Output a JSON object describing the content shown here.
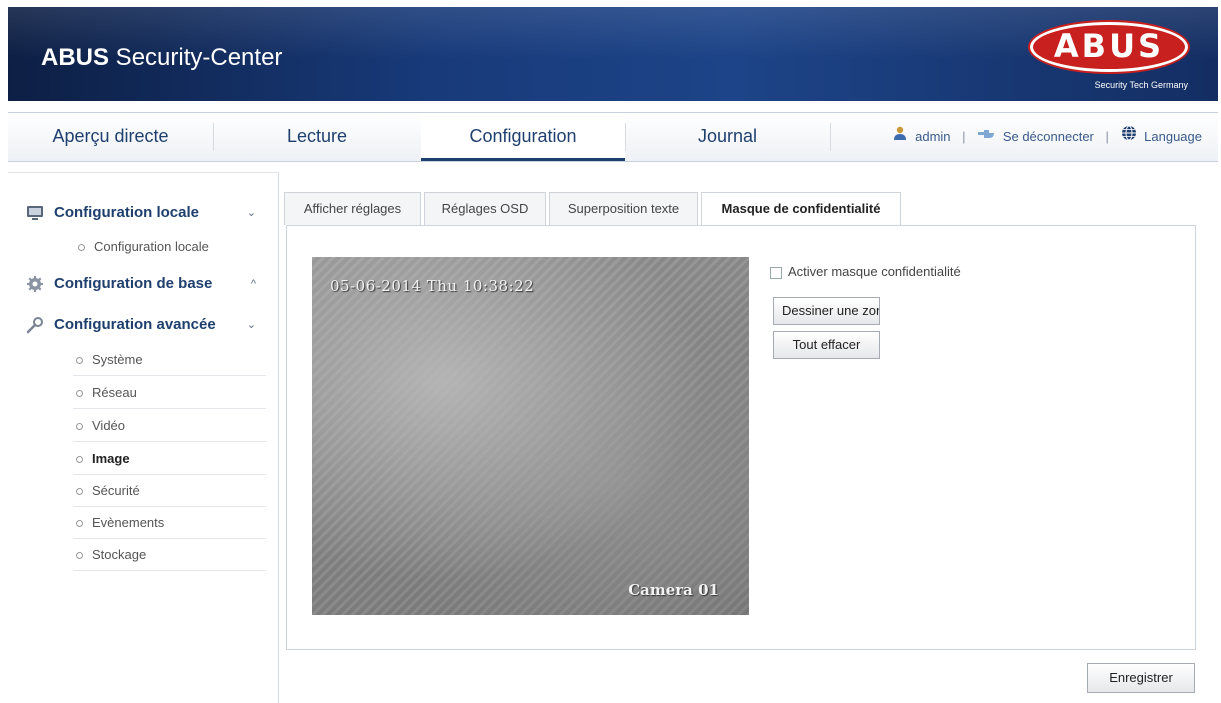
{
  "header": {
    "title_bold": "ABUS",
    "title_rest": " Security-Center",
    "logo_text": "ABUS",
    "logo_tagline": "Security Tech Germany"
  },
  "nav": {
    "tabs": [
      {
        "label": "Aperçu directe"
      },
      {
        "label": "Lecture"
      },
      {
        "label": "Configuration"
      },
      {
        "label": "Journal"
      }
    ],
    "active_tab": "Configuration",
    "user": "admin",
    "logout": "Se déconnecter",
    "language": "Language",
    "separator": "|"
  },
  "sidebar": {
    "groups": [
      {
        "label": "Configuration locale",
        "chevron": "⌄",
        "icon": "computer-icon"
      },
      {
        "label": "Configuration de base",
        "chevron": "^",
        "icon": "gear-icon"
      },
      {
        "label": "Configuration avancée",
        "chevron": "⌄",
        "icon": "wrench-icon"
      }
    ],
    "local_items": [
      "Configuration locale"
    ],
    "advanced_items": [
      "Système",
      "Réseau",
      "Vidéo",
      "Image",
      "Sécurité",
      "Evènements",
      "Stockage"
    ],
    "active_item": "Image"
  },
  "subtabs": {
    "items": [
      "Afficher réglages",
      "Réglages OSD",
      "Superposition texte",
      "Masque de confidentialité"
    ],
    "active": "Masque de confidentialité"
  },
  "video": {
    "timestamp": "05-06-2014 Thu 10:38:22",
    "camera_label": "Camera 01"
  },
  "privacy_mask": {
    "enable_label": "Activer masque confidentialité",
    "enabled": false,
    "draw_button": "Dessiner une zone",
    "clear_button": "Tout effacer"
  },
  "footer": {
    "save_button": "Enregistrer"
  },
  "colors": {
    "header_bg": "#183a7a",
    "nav_text": "#1f3f6e",
    "logo_red": "#c8201e"
  }
}
